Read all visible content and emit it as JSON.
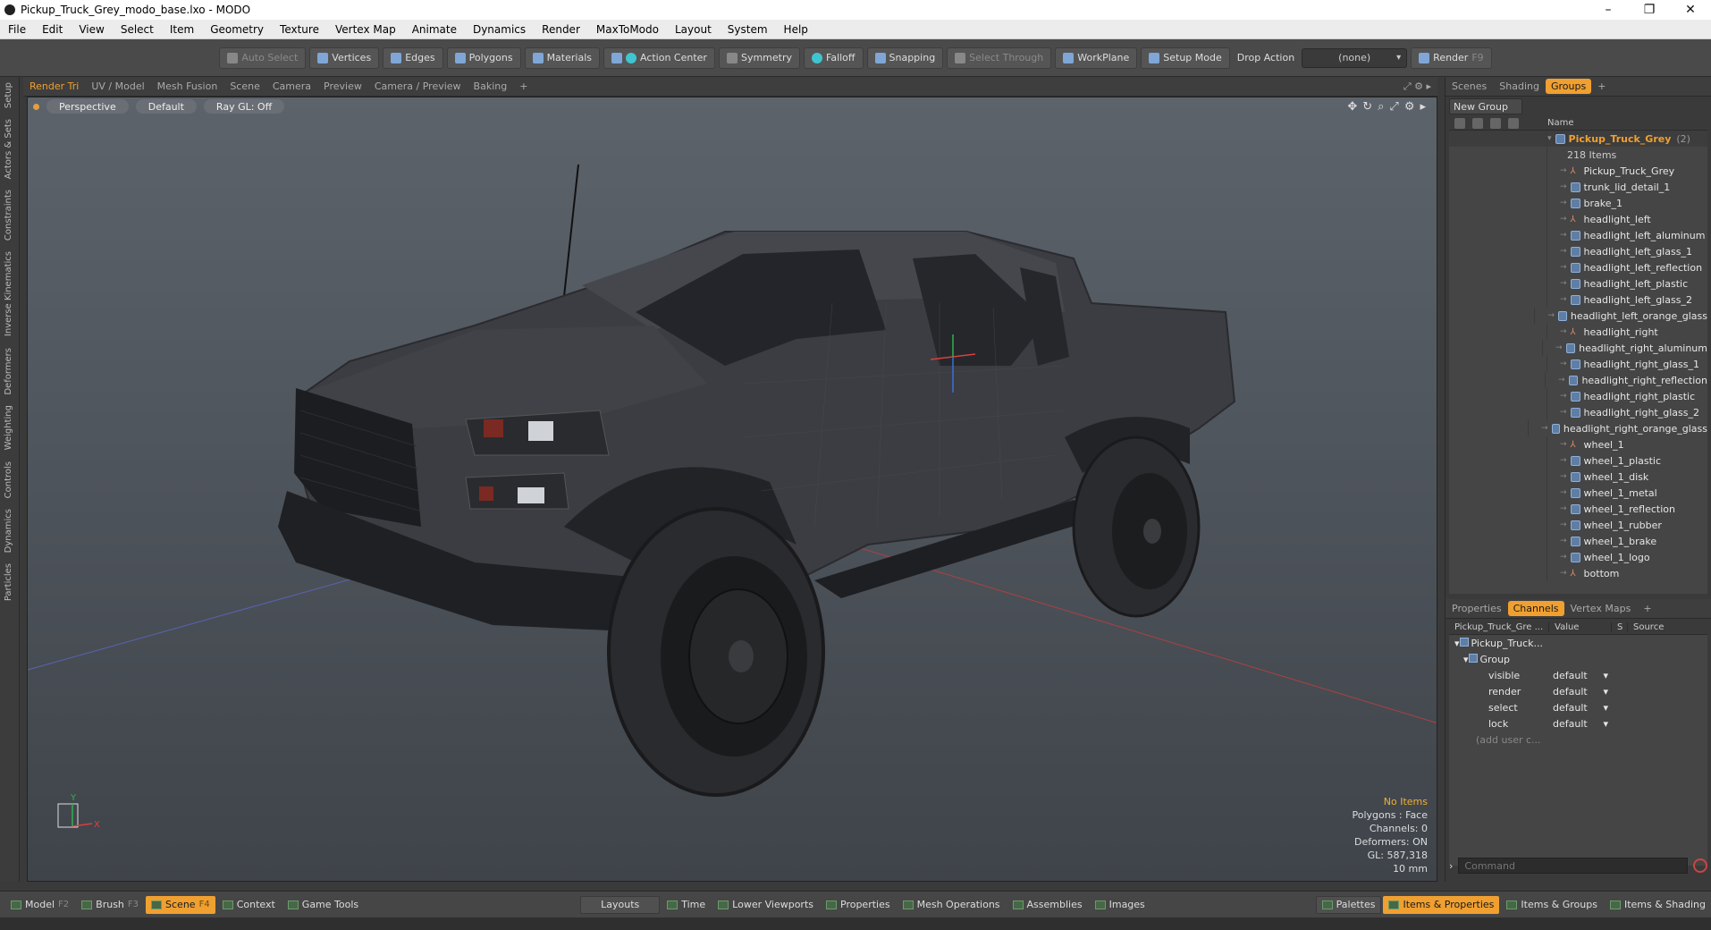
{
  "window": {
    "title": "Pickup_Truck_Grey_modo_base.lxo - MODO",
    "controls": [
      "–",
      "❐",
      "✕"
    ]
  },
  "menu": [
    "File",
    "Edit",
    "View",
    "Select",
    "Item",
    "Geometry",
    "Texture",
    "Vertex Map",
    "Animate",
    "Dynamics",
    "Render",
    "MaxToModo",
    "Layout",
    "System",
    "Help"
  ],
  "toolbar": {
    "auto_select": "Auto Select",
    "vertices": "Vertices",
    "edges": "Edges",
    "polygons": "Polygons",
    "materials": "Materials",
    "action_center": "Action Center",
    "symmetry": "Symmetry",
    "falloff": "Falloff",
    "snapping": "Snapping",
    "select_through": "Select Through",
    "workplane": "WorkPlane",
    "setup_mode": "Setup Mode",
    "drop_action_label": "Drop Action",
    "drop_action_value": "(none)",
    "render": "Render",
    "render_key": "F9"
  },
  "left_tabs": [
    "Setup",
    "Actors & Sets",
    "Constraints",
    "Inverse Kinematics",
    "Deformers",
    "Weighting",
    "Controls",
    "Dynamics",
    "Particles"
  ],
  "viewport_tabs": {
    "items": [
      "Render Tri",
      "UV / Model",
      "Mesh Fusion",
      "Scene",
      "Camera",
      "Preview",
      "Camera / Preview",
      "Baking"
    ],
    "add": "+"
  },
  "viewport": {
    "projection": "Perspective",
    "shading": "Default",
    "raygl": "Ray GL: Off",
    "stats": {
      "selection": "No Items",
      "polygons": "Polygons : Face",
      "channels": "Channels: 0",
      "deformers": "Deformers: ON",
      "gl": "GL: 587,318",
      "units": "10 mm"
    },
    "axis": {
      "x": "X",
      "y": "Y"
    }
  },
  "right_panel": {
    "tabs": [
      "Scenes",
      "Shading",
      "Groups"
    ],
    "active_tab": "Groups",
    "new_group": "New Group",
    "name_col": "Name",
    "root": {
      "name": "Pickup_Truck_Grey",
      "count": "(2)",
      "items": "218 Items"
    },
    "children": [
      {
        "name": "Pickup_Truck_Grey",
        "type": "loc"
      },
      {
        "name": "trunk_lid_detail_1",
        "type": "mesh"
      },
      {
        "name": "brake_1",
        "type": "mesh"
      },
      {
        "name": "headlight_left",
        "type": "loc"
      },
      {
        "name": "headlight_left_aluminum",
        "type": "mesh"
      },
      {
        "name": "headlight_left_glass_1",
        "type": "mesh"
      },
      {
        "name": "headlight_left_reflection",
        "type": "mesh"
      },
      {
        "name": "headlight_left_plastic",
        "type": "mesh"
      },
      {
        "name": "headlight_left_glass_2",
        "type": "mesh"
      },
      {
        "name": "headlight_left_orange_glass",
        "type": "mesh"
      },
      {
        "name": "headlight_right",
        "type": "loc"
      },
      {
        "name": "headlight_right_aluminum",
        "type": "mesh"
      },
      {
        "name": "headlight_right_glass_1",
        "type": "mesh"
      },
      {
        "name": "headlight_right_reflection",
        "type": "mesh"
      },
      {
        "name": "headlight_right_plastic",
        "type": "mesh"
      },
      {
        "name": "headlight_right_glass_2",
        "type": "mesh"
      },
      {
        "name": "headlight_right_orange_glass",
        "type": "mesh"
      },
      {
        "name": "wheel_1",
        "type": "loc"
      },
      {
        "name": "wheel_1_plastic",
        "type": "mesh"
      },
      {
        "name": "wheel_1_disk",
        "type": "mesh"
      },
      {
        "name": "wheel_1_metal",
        "type": "mesh"
      },
      {
        "name": "wheel_1_reflection",
        "type": "mesh"
      },
      {
        "name": "wheel_1_rubber",
        "type": "mesh"
      },
      {
        "name": "wheel_1_brake",
        "type": "mesh"
      },
      {
        "name": "wheel_1_logo",
        "type": "mesh"
      },
      {
        "name": "bottom",
        "type": "loc"
      }
    ],
    "prop_tabs": [
      "Properties",
      "Channels",
      "Vertex Maps"
    ],
    "active_prop_tab": "Channels",
    "channel_cols": [
      "Pickup_Truck_Gre ...",
      "Value",
      "S",
      "Source"
    ],
    "channel_tree": [
      "Pickup_Truck...",
      "Group"
    ],
    "channels": [
      {
        "name": "visible",
        "value": "default"
      },
      {
        "name": "render",
        "value": "default"
      },
      {
        "name": "select",
        "value": "default"
      },
      {
        "name": "lock",
        "value": "default"
      }
    ],
    "add_user": "(add user c...",
    "command_placeholder": "Command"
  },
  "bottom_bar": {
    "model": "Model",
    "model_key": "F2",
    "brush": "Brush",
    "brush_key": "F3",
    "scene": "Scene",
    "scene_key": "F4",
    "context": "Context",
    "game_tools": "Game Tools",
    "layouts": "Layouts",
    "time": "Time",
    "lower_viewports": "Lower Viewports",
    "properties": "Properties",
    "mesh_operations": "Mesh Operations",
    "assemblies": "Assemblies",
    "images": "Images",
    "palettes": "Palettes",
    "items_properties": "Items & Properties",
    "items_groups": "Items & Groups",
    "items_shading": "Items & Shading"
  },
  "colors": {
    "accent": "#f0a030",
    "truck_body": "#3b3d42",
    "viewport_top": "#5d636b",
    "viewport_bottom": "#3f444a"
  }
}
